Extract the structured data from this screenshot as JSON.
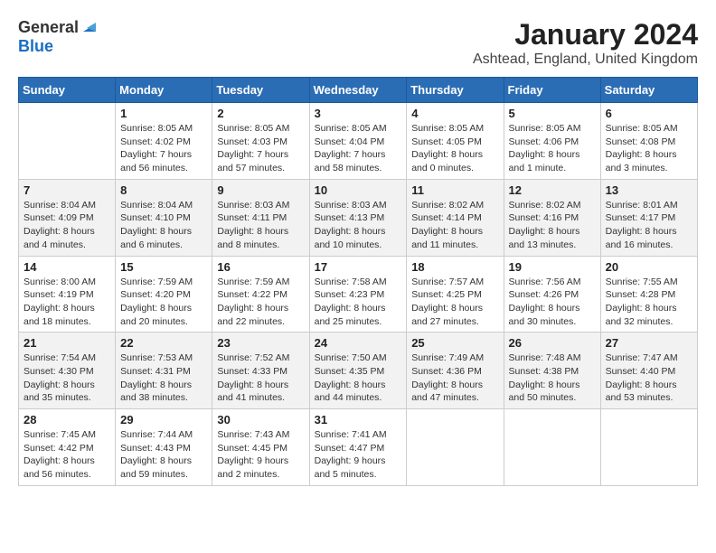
{
  "logo": {
    "general": "General",
    "blue": "Blue"
  },
  "title": "January 2024",
  "location": "Ashtead, England, United Kingdom",
  "weekdays": [
    "Sunday",
    "Monday",
    "Tuesday",
    "Wednesday",
    "Thursday",
    "Friday",
    "Saturday"
  ],
  "weeks": [
    [
      {
        "day": "",
        "info": ""
      },
      {
        "day": "1",
        "info": "Sunrise: 8:05 AM\nSunset: 4:02 PM\nDaylight: 7 hours\nand 56 minutes."
      },
      {
        "day": "2",
        "info": "Sunrise: 8:05 AM\nSunset: 4:03 PM\nDaylight: 7 hours\nand 57 minutes."
      },
      {
        "day": "3",
        "info": "Sunrise: 8:05 AM\nSunset: 4:04 PM\nDaylight: 7 hours\nand 58 minutes."
      },
      {
        "day": "4",
        "info": "Sunrise: 8:05 AM\nSunset: 4:05 PM\nDaylight: 8 hours\nand 0 minutes."
      },
      {
        "day": "5",
        "info": "Sunrise: 8:05 AM\nSunset: 4:06 PM\nDaylight: 8 hours\nand 1 minute."
      },
      {
        "day": "6",
        "info": "Sunrise: 8:05 AM\nSunset: 4:08 PM\nDaylight: 8 hours\nand 3 minutes."
      }
    ],
    [
      {
        "day": "7",
        "info": "Sunrise: 8:04 AM\nSunset: 4:09 PM\nDaylight: 8 hours\nand 4 minutes."
      },
      {
        "day": "8",
        "info": "Sunrise: 8:04 AM\nSunset: 4:10 PM\nDaylight: 8 hours\nand 6 minutes."
      },
      {
        "day": "9",
        "info": "Sunrise: 8:03 AM\nSunset: 4:11 PM\nDaylight: 8 hours\nand 8 minutes."
      },
      {
        "day": "10",
        "info": "Sunrise: 8:03 AM\nSunset: 4:13 PM\nDaylight: 8 hours\nand 10 minutes."
      },
      {
        "day": "11",
        "info": "Sunrise: 8:02 AM\nSunset: 4:14 PM\nDaylight: 8 hours\nand 11 minutes."
      },
      {
        "day": "12",
        "info": "Sunrise: 8:02 AM\nSunset: 4:16 PM\nDaylight: 8 hours\nand 13 minutes."
      },
      {
        "day": "13",
        "info": "Sunrise: 8:01 AM\nSunset: 4:17 PM\nDaylight: 8 hours\nand 16 minutes."
      }
    ],
    [
      {
        "day": "14",
        "info": "Sunrise: 8:00 AM\nSunset: 4:19 PM\nDaylight: 8 hours\nand 18 minutes."
      },
      {
        "day": "15",
        "info": "Sunrise: 7:59 AM\nSunset: 4:20 PM\nDaylight: 8 hours\nand 20 minutes."
      },
      {
        "day": "16",
        "info": "Sunrise: 7:59 AM\nSunset: 4:22 PM\nDaylight: 8 hours\nand 22 minutes."
      },
      {
        "day": "17",
        "info": "Sunrise: 7:58 AM\nSunset: 4:23 PM\nDaylight: 8 hours\nand 25 minutes."
      },
      {
        "day": "18",
        "info": "Sunrise: 7:57 AM\nSunset: 4:25 PM\nDaylight: 8 hours\nand 27 minutes."
      },
      {
        "day": "19",
        "info": "Sunrise: 7:56 AM\nSunset: 4:26 PM\nDaylight: 8 hours\nand 30 minutes."
      },
      {
        "day": "20",
        "info": "Sunrise: 7:55 AM\nSunset: 4:28 PM\nDaylight: 8 hours\nand 32 minutes."
      }
    ],
    [
      {
        "day": "21",
        "info": "Sunrise: 7:54 AM\nSunset: 4:30 PM\nDaylight: 8 hours\nand 35 minutes."
      },
      {
        "day": "22",
        "info": "Sunrise: 7:53 AM\nSunset: 4:31 PM\nDaylight: 8 hours\nand 38 minutes."
      },
      {
        "day": "23",
        "info": "Sunrise: 7:52 AM\nSunset: 4:33 PM\nDaylight: 8 hours\nand 41 minutes."
      },
      {
        "day": "24",
        "info": "Sunrise: 7:50 AM\nSunset: 4:35 PM\nDaylight: 8 hours\nand 44 minutes."
      },
      {
        "day": "25",
        "info": "Sunrise: 7:49 AM\nSunset: 4:36 PM\nDaylight: 8 hours\nand 47 minutes."
      },
      {
        "day": "26",
        "info": "Sunrise: 7:48 AM\nSunset: 4:38 PM\nDaylight: 8 hours\nand 50 minutes."
      },
      {
        "day": "27",
        "info": "Sunrise: 7:47 AM\nSunset: 4:40 PM\nDaylight: 8 hours\nand 53 minutes."
      }
    ],
    [
      {
        "day": "28",
        "info": "Sunrise: 7:45 AM\nSunset: 4:42 PM\nDaylight: 8 hours\nand 56 minutes."
      },
      {
        "day": "29",
        "info": "Sunrise: 7:44 AM\nSunset: 4:43 PM\nDaylight: 8 hours\nand 59 minutes."
      },
      {
        "day": "30",
        "info": "Sunrise: 7:43 AM\nSunset: 4:45 PM\nDaylight: 9 hours\nand 2 minutes."
      },
      {
        "day": "31",
        "info": "Sunrise: 7:41 AM\nSunset: 4:47 PM\nDaylight: 9 hours\nand 5 minutes."
      },
      {
        "day": "",
        "info": ""
      },
      {
        "day": "",
        "info": ""
      },
      {
        "day": "",
        "info": ""
      }
    ]
  ]
}
